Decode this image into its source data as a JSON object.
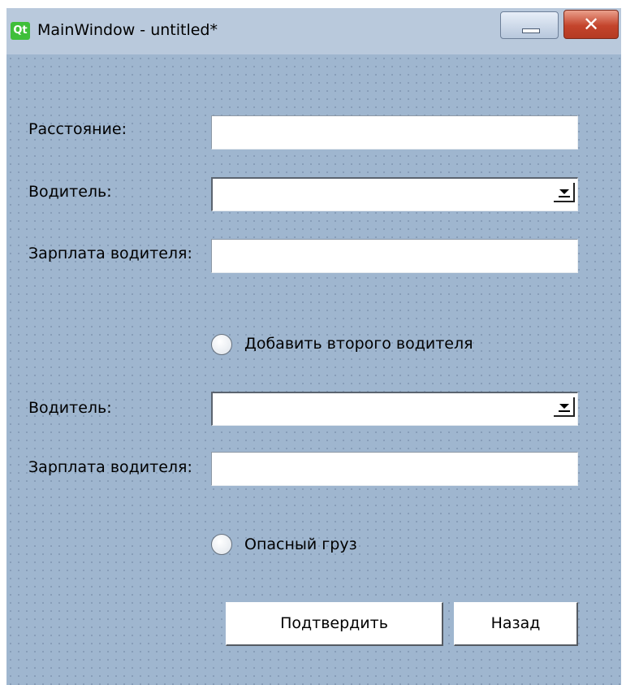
{
  "window": {
    "title": "MainWindow - untitled*",
    "app_icon": "Qt",
    "minimize_icon": "minimize-icon",
    "close_icon": "close-icon",
    "close_glyph": "✕",
    "colors": {
      "background": "#9fb6cf",
      "close_button": "#c4442c"
    }
  },
  "form": {
    "distance_label": "Расстояние:",
    "distance_value": "",
    "driver1_label": "Водитель:",
    "driver1_value": "",
    "salary1_label": "Зарплата водителя:",
    "salary1_value": "",
    "add_second_driver_label": "Добавить второго водителя",
    "add_second_driver_checked": false,
    "driver2_label": "Водитель:",
    "driver2_value": "",
    "salary2_label": "Зарплата водителя:",
    "salary2_value": "",
    "dangerous_cargo_label": "Опасный груз",
    "dangerous_cargo_checked": false
  },
  "buttons": {
    "confirm_label": "Подтвердить",
    "back_label": "Назад"
  }
}
